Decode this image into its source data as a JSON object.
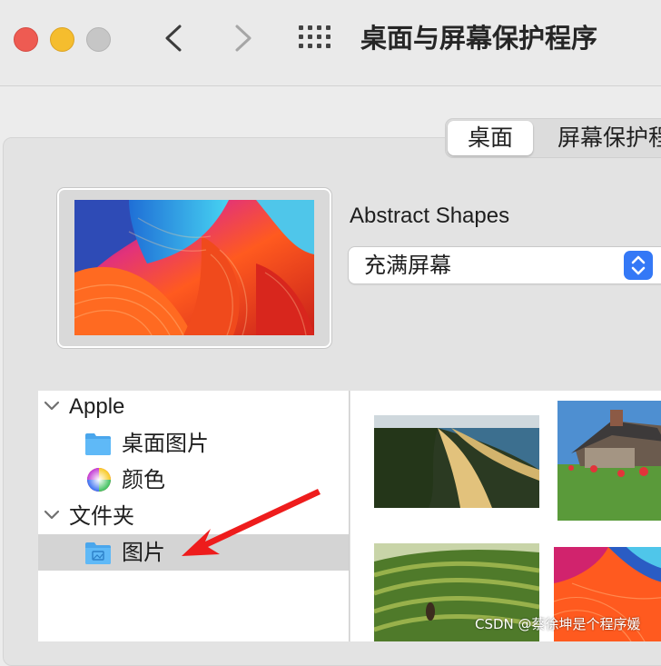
{
  "window": {
    "title": "桌面与屏幕保护程序"
  },
  "tabs": {
    "desktop": "桌面",
    "screensaver": "屏幕保护程"
  },
  "current": {
    "wallpaper_name": "Abstract Shapes",
    "fill_mode": "充满屏幕"
  },
  "sidebar": {
    "groups": [
      {
        "label": "Apple",
        "expanded": true,
        "items": [
          {
            "label": "桌面图片",
            "icon": "folder-icon"
          },
          {
            "label": "颜色",
            "icon": "color-wheel-icon"
          }
        ]
      },
      {
        "label": "文件夹",
        "expanded": true,
        "items": [
          {
            "label": "图片",
            "icon": "pictures-folder-icon",
            "selected": true
          }
        ]
      }
    ]
  },
  "thumbnails": [
    {
      "name": "dune-coast-thumbnail"
    },
    {
      "name": "stone-house-thumbnail"
    },
    {
      "name": "rice-terraces-thumbnail"
    },
    {
      "name": "abstract-shapes-thumbnail"
    }
  ],
  "watermark": "CSDN @蔡徐坤是个程序媛",
  "colors": {
    "accent": "#3478f6",
    "close": "#ee5b52",
    "minimize": "#f5bd2e",
    "arrow": "#ee1c1c"
  }
}
